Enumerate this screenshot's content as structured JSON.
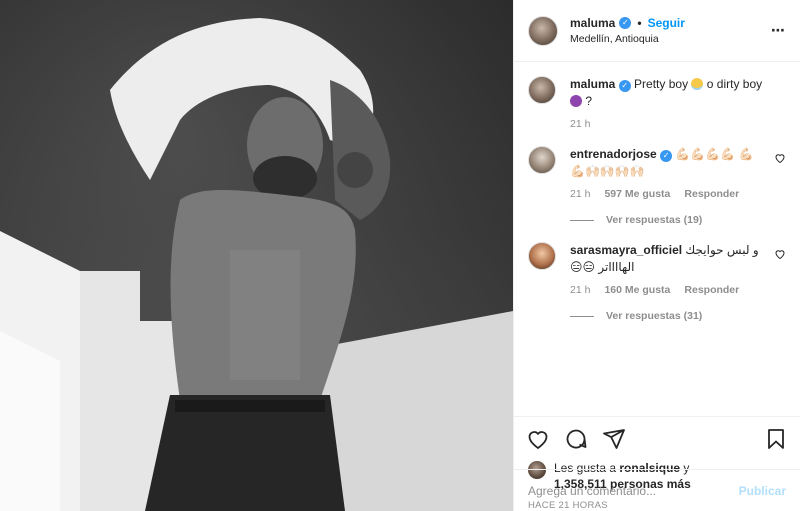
{
  "post": {
    "username": "maluma",
    "follow_label": "Seguir",
    "dot": "•",
    "location": "Medellín, Antioquia",
    "more_icon": "⋯",
    "caption": {
      "username": "maluma",
      "text_1": "Pretty boy",
      "text_2": "o dirty boy",
      "text_3": "?",
      "time": "21 h"
    },
    "comments": [
      {
        "username": "entrenadorjose",
        "text": "💪🏻💪🏻💪🏻💪🏻 💪🏻💪🏻🙌🏻🙌🏻🙌🏻🙌🏻",
        "time": "21 h",
        "likes": "597 Me gusta",
        "reply": "Responder",
        "view_replies": "Ver respuestas (19)"
      },
      {
        "username": "sarasmayra_officiel",
        "text": "و لبس حوايجك الهااااتر 😑😑",
        "time": "21 h",
        "likes": "160 Me gusta",
        "reply": "Responder",
        "view_replies": "Ver respuestas (31)"
      }
    ],
    "likes": {
      "prefix": "Les gusta a",
      "user": "ronalsique",
      "suffix": "y",
      "count": "1,358,511 personas más"
    },
    "time_ago": "HACE 21 HORAS",
    "add_comment_placeholder": "Agrega un comentario...",
    "publish_label": "Publicar"
  },
  "colors": {
    "accent": "#0095f6",
    "verified": "#3897f0",
    "muted": "#8e8e8e",
    "publish_disabled": "#b2dffc"
  },
  "icons": [
    "verified-badge-icon",
    "more-options-icon",
    "heart-icon",
    "comment-icon",
    "share-icon",
    "bookmark-icon",
    "small-heart-icon"
  ]
}
